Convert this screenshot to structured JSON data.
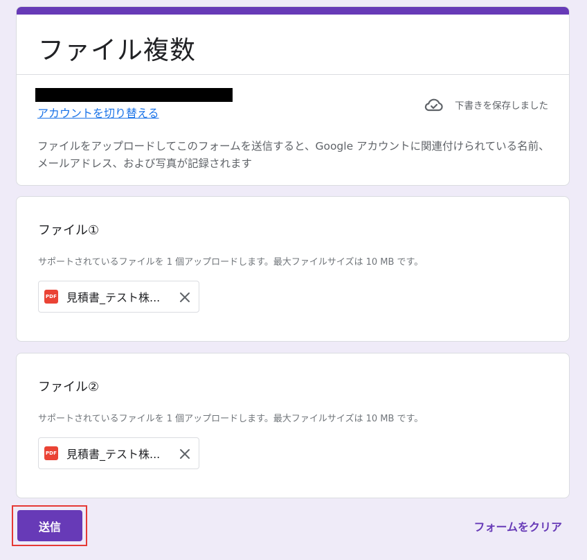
{
  "colors": {
    "accent": "#673ab7",
    "link": "#1a73e8",
    "page_background": "#efebf8",
    "highlight_border": "#e53935",
    "pdf_red": "#ea4335"
  },
  "header": {
    "title": "ファイル複数",
    "switch_account": "アカウントを切り替える",
    "save_status": "下書きを保存しました",
    "disclaimer": "ファイルをアップロードしてこのフォームを送信すると、Google アカウントに関連付けられている名前、メールアドレス、および写真が記録されます"
  },
  "questions": [
    {
      "title": "ファイル①",
      "description": "サポートされているファイルを 1 個アップロードします。最大ファイルサイズは 10 MB です。",
      "file": {
        "icon": "pdf-file-icon",
        "badge": "PDF",
        "name": "見積書_テスト株..."
      }
    },
    {
      "title": "ファイル②",
      "description": "サポートされているファイルを 1 個アップロードします。最大ファイルサイズは 10 MB です。",
      "file": {
        "icon": "pdf-file-icon",
        "badge": "PDF",
        "name": "見積書_テスト株..."
      }
    }
  ],
  "footer": {
    "submit_label": "送信",
    "clear_label": "フォームをクリア"
  }
}
